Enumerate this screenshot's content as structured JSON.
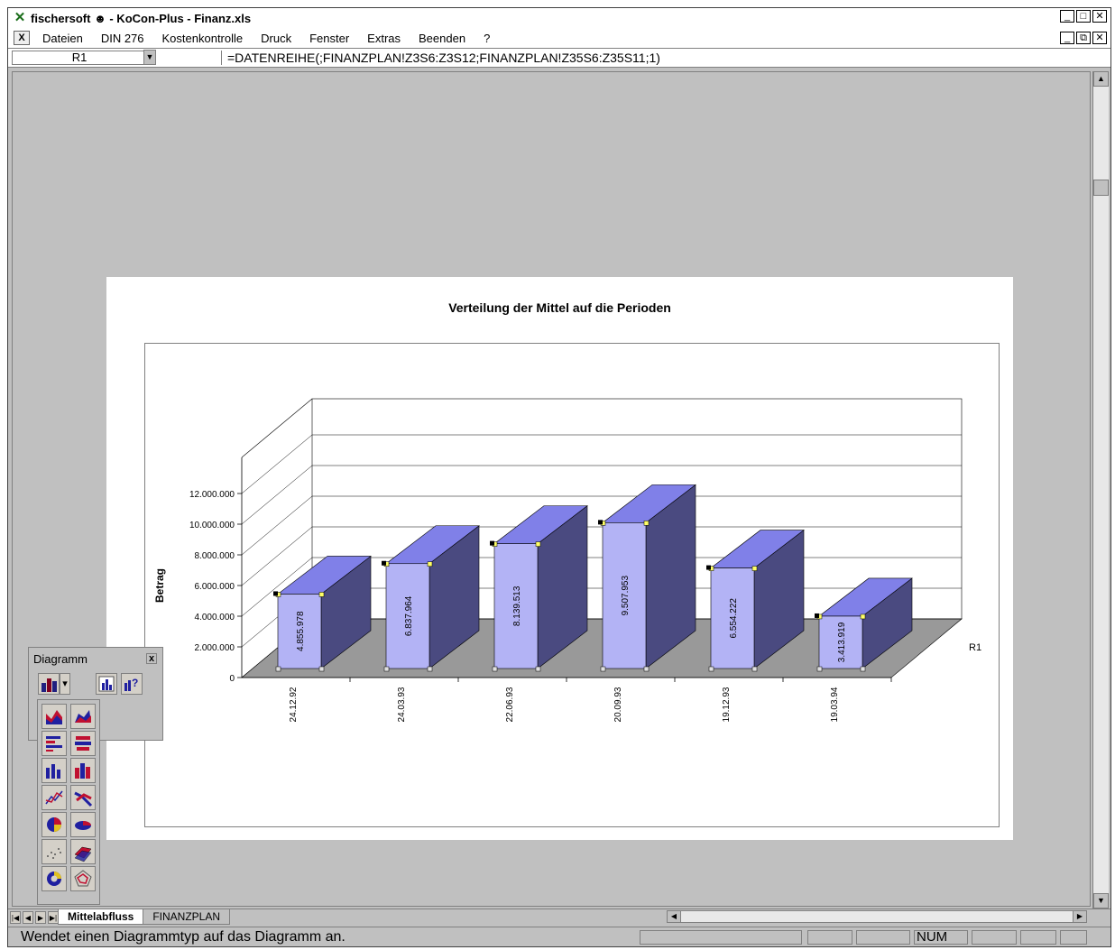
{
  "window": {
    "title": "fischersoft ☻  -  KoCon-Plus - Finanz.xls",
    "btn_min": "_",
    "btn_max": "□",
    "btn_close": "✕",
    "doc_btn_min": "_",
    "doc_btn_restore": "⧉",
    "doc_btn_close": "✕"
  },
  "menu": {
    "items": [
      "Dateien",
      "DIN 276",
      "Kostenkontrolle",
      "Druck",
      "Fenster",
      "Extras",
      "Beenden",
      "?"
    ]
  },
  "formula_bar": {
    "name_box": "R1",
    "formula": "=DATENREIHE(;FINANZPLAN!Z3S6:Z3S12;FINANZPLAN!Z35S6:Z35S11;1)"
  },
  "chart_data": {
    "type": "bar",
    "variant": "3d-column",
    "title": "Verteilung der Mittel auf die Perioden",
    "xlabel": "",
    "ylabel": "Betrag",
    "categories": [
      "24.12.92",
      "24.03.93",
      "22.06.93",
      "20.09.93",
      "19.12.93",
      "19.03.94"
    ],
    "series": [
      {
        "name": "R1",
        "values": [
          4855978,
          6837964,
          8139513,
          9507953,
          6554222,
          3413919
        ]
      }
    ],
    "data_labels": [
      "4.855.978",
      "6.837.964",
      "8.139.513",
      "9.507.953",
      "6.554.222",
      "3.413.919"
    ],
    "yticks": [
      "0",
      "2.000.000",
      "4.000.000",
      "6.000.000",
      "8.000.000",
      "10.000.000",
      "12.000.000"
    ],
    "ylim": [
      0,
      12000000
    ],
    "depth_label": "R1",
    "bar_front_color": "#b3b3f5",
    "bar_top_color": "#8080e8",
    "bar_side_color": "#4a4a80",
    "floor_color": "#999999",
    "grid": true
  },
  "toolbar": {
    "title": "Diagramm",
    "close": "x"
  },
  "sheet_tabs": {
    "tabs": [
      "Mittelabfluss",
      "FINANZPLAN"
    ],
    "active": "Mittelabfluss"
  },
  "status": {
    "message": "Wendet einen Diagrammtyp auf das Diagramm an.",
    "num": "NUM"
  }
}
